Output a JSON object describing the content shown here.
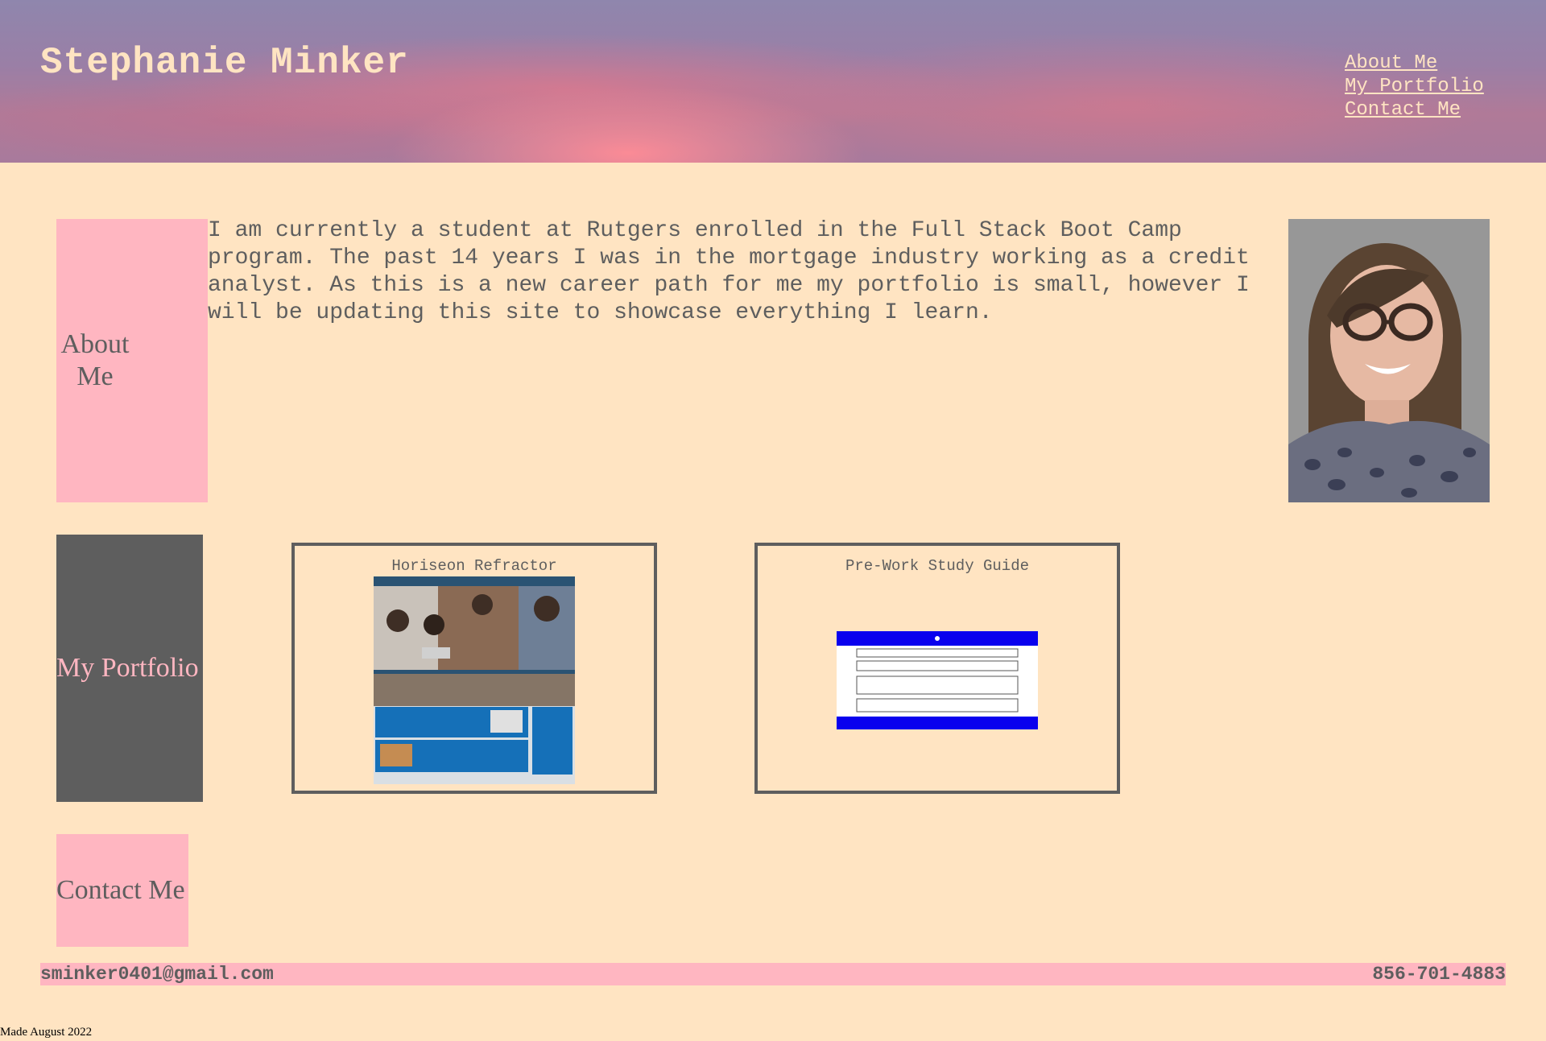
{
  "header": {
    "title": "Stephanie Minker",
    "nav": [
      "About Me",
      "My Portfolio",
      "Contact Me"
    ]
  },
  "sections": {
    "about_label": "About Me",
    "portfolio_label": "My Portfolio",
    "contact_label": "Contact Me"
  },
  "about": {
    "text": "I am currently a student at Rutgers enrolled in the Full Stack Boot Camp program. The past 14 years I was in the mortgage industry working as a credit analyst. As this is a new career path for me my portfolio is small, however I will be updating this site to showcase everything I learn."
  },
  "portfolio": {
    "projects": [
      {
        "title": "Horiseon Refractor"
      },
      {
        "title": "Pre-Work Study Guide"
      }
    ]
  },
  "footer": {
    "email": "sminker0401@gmail.com",
    "phone": "856-701-4883",
    "note": "Made August 2022"
  },
  "colors": {
    "background": "#ffe4c2",
    "pink": "#ffb6c1",
    "gray": "#5e5e5e"
  }
}
